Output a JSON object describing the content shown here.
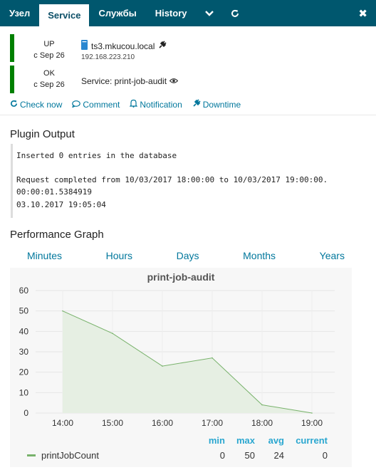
{
  "tabs": {
    "node": "Узел",
    "service": "Service",
    "services": "Службы",
    "history": "History"
  },
  "host": {
    "state": "UP",
    "since": "с Sep 26",
    "name": "ts3.mkucou.local",
    "ip": "192.168.223.210"
  },
  "service": {
    "state": "OK",
    "since": "с Sep 26",
    "label": "Service: print-job-audit"
  },
  "actions": {
    "check_now": "Check now",
    "comment": "Comment",
    "notification": "Notification",
    "downtime": "Downtime"
  },
  "plugin": {
    "title": "Plugin Output",
    "line1": "Inserted 0 entries in the database",
    "line2": "Request completed from 10/03/2017 18:00:00 to 10/03/2017 19:00:00.",
    "line3": "00:00:01.5384919",
    "line4": "03.10.2017 19:05:04"
  },
  "perf": {
    "title": "Performance Graph",
    "ranges": [
      "Minutes",
      "Hours",
      "Days",
      "Months",
      "Years"
    ]
  },
  "colors": {
    "tabbar": "#00576e",
    "ok": "#008000",
    "link": "#00779c",
    "series": "#78b26b"
  },
  "chart_data": {
    "type": "area",
    "title": "print-job-audit",
    "x": [
      "14:00",
      "15:00",
      "16:00",
      "17:00",
      "18:00",
      "19:00"
    ],
    "points": [
      {
        "x": "14:00",
        "y": 50
      },
      {
        "x": "15:00",
        "y": 39
      },
      {
        "x": "16:00",
        "y": 23
      },
      {
        "x": "17:00",
        "y": 27
      },
      {
        "x": "18:00",
        "y": 4
      },
      {
        "x": "19:00",
        "y": 0
      }
    ],
    "ylim": [
      0,
      60
    ],
    "yticks": [
      "0",
      "10",
      "20",
      "30",
      "40",
      "50",
      "60"
    ],
    "grid": true,
    "legend": {
      "headers": [
        "min",
        "max",
        "avg",
        "current"
      ],
      "series": [
        {
          "name": "printJobCount",
          "min": "0",
          "max": "50",
          "avg": "24",
          "current": "0"
        }
      ]
    }
  }
}
